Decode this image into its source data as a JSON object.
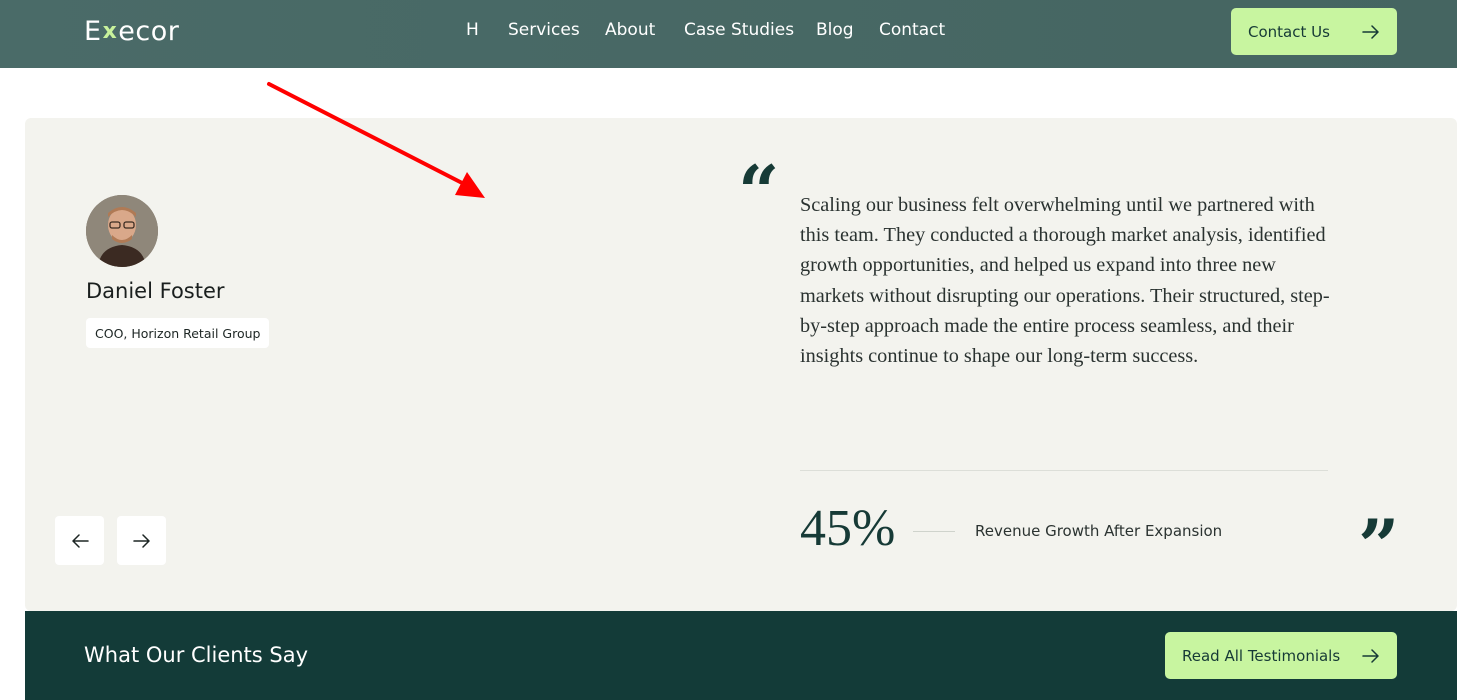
{
  "brand": {
    "prefix": "E",
    "mark": "x",
    "suffix": "ecor"
  },
  "nav": {
    "items": [
      "H",
      "Services",
      "About",
      "Case Studies",
      "Blog",
      "Contact"
    ],
    "cta_label": "Contact Us"
  },
  "testimonial": {
    "name": "Daniel Foster",
    "role": "COO, Horizon Retail Group",
    "quote": "Scaling our business felt overwhelming until we partnered with this team. They conducted a thorough market analysis, identified growth opportunities, and helped us expand into three new markets without disrupting our operations. Their structured, step-by-step approach made the entire process seamless, and their insights continue to shape our long-term success.",
    "stat_value": "45%",
    "stat_label": "Revenue Growth After Expansion",
    "quote_open": "“",
    "quote_close": "”"
  },
  "footer": {
    "title": "What Our Clients Say",
    "cta_label": "Read All Testimonials"
  },
  "colors": {
    "accent": "#c8f5a0",
    "dark": "#133b38",
    "nav_bg": "#4a6b68",
    "card_bg": "#f3f3ee",
    "annotation": "#ff0000"
  },
  "icons": {
    "arrow_right": "arrow-right-icon",
    "arrow_left": "arrow-left-icon",
    "annotation": "red-arrow-annotation"
  }
}
